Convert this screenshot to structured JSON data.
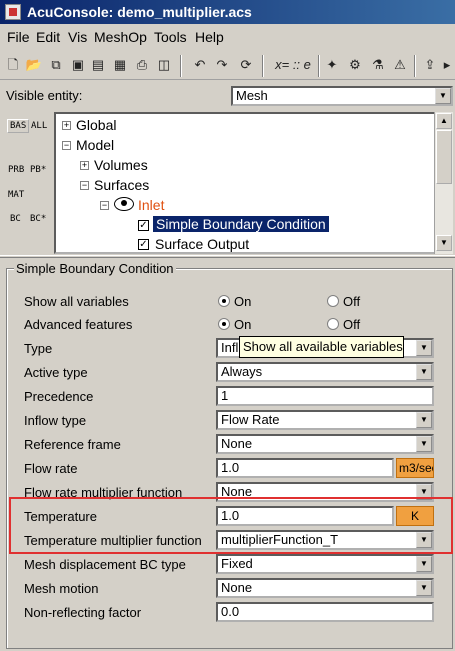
{
  "window": {
    "title": "AcuConsole:  demo_multiplier.acs"
  },
  "menu": [
    "File",
    "Edit",
    "Vis",
    "MeshOp",
    "Tools",
    "Help"
  ],
  "toolbar": {
    "expr_label": "x= :: e"
  },
  "visible_entity": {
    "label": "Visible entity:",
    "value": "Mesh"
  },
  "side_labels": {
    "bas": "BAS",
    "all": "ALL",
    "prb": "PRB",
    "pbstar": "PB*",
    "mat": "MAT",
    "bc": "BC",
    "bcstar": "BC*"
  },
  "tree": {
    "global": "Global",
    "model": "Model",
    "volumes": "Volumes",
    "surfaces": "Surfaces",
    "inlet": "Inlet",
    "sbc": "Simple Boundary Condition",
    "surface_output": "Surface Output"
  },
  "panel": {
    "title": "Simple Boundary Condition",
    "rows": {
      "show_all": {
        "label": "Show all variables",
        "on": "On",
        "off": "Off",
        "selected": "On"
      },
      "advanced": {
        "label": "Advanced features",
        "on": "On",
        "off": "Off",
        "selected": "On"
      },
      "type": {
        "label": "Type",
        "value": "Infl"
      },
      "active_type": {
        "label": "Active type",
        "value": "Always"
      },
      "precedence": {
        "label": "Precedence",
        "value": "1"
      },
      "inflow_type": {
        "label": "Inflow type",
        "value": "Flow Rate"
      },
      "reference_frame": {
        "label": "Reference frame",
        "value": "None"
      },
      "flow_rate": {
        "label": "Flow rate",
        "value": "1.0",
        "unit": "m3/sec"
      },
      "flow_rate_mult": {
        "label": "Flow rate multiplier function",
        "value": "None"
      },
      "temperature": {
        "label": "Temperature",
        "value": "1.0",
        "unit": "K"
      },
      "temp_mult": {
        "label": "Temperature multiplier function",
        "value": "multiplierFunction_T"
      },
      "mesh_disp": {
        "label": "Mesh displacement BC type",
        "value": "Fixed"
      },
      "mesh_motion": {
        "label": "Mesh motion",
        "value": "None"
      },
      "nonrefl": {
        "label": "Non-reflecting factor",
        "value": "0.0"
      }
    },
    "tooltip": "Show all available variables"
  },
  "colors": {
    "title_bar": "#0a246a",
    "selection": "#0a246a",
    "unit_button": "#f0a040",
    "highlight_box": "#e03030",
    "inlet_text": "#e05010"
  }
}
